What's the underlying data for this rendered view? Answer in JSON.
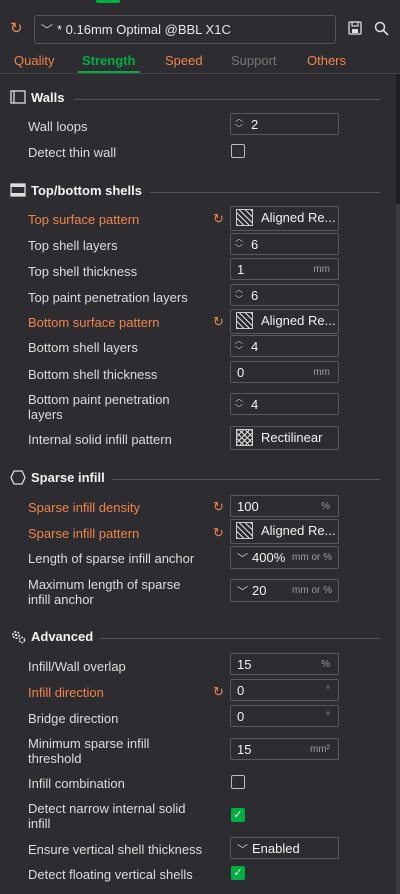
{
  "header": {
    "preset_name": "* 0.16mm Optimal @BBL X1C",
    "icons": {
      "reset": "reset-icon",
      "save": "save-icon",
      "search": "search-icon"
    }
  },
  "tabs": [
    {
      "label": "Quality",
      "state": "modified"
    },
    {
      "label": "Strength",
      "state": "active"
    },
    {
      "label": "Speed",
      "state": "modified"
    },
    {
      "label": "Support",
      "state": "disabled"
    },
    {
      "label": "Others",
      "state": "modified"
    }
  ],
  "colors": {
    "accent": "#00ae42",
    "modified": "#f0844a",
    "background": "#2d2d31"
  },
  "walls": {
    "title": "Walls",
    "wall_loops": {
      "label": "Wall loops",
      "value": "2"
    },
    "detect_thin_wall": {
      "label": "Detect thin wall",
      "checked": false
    }
  },
  "shells": {
    "title": "Top/bottom shells",
    "top_surface_pattern": {
      "label": "Top surface pattern",
      "value": "Aligned Re..."
    },
    "top_shell_layers": {
      "label": "Top shell layers",
      "value": "6"
    },
    "top_shell_thickness": {
      "label": "Top shell thickness",
      "value": "1",
      "unit": "mm"
    },
    "top_paint_layers": {
      "label": "Top paint penetration layers",
      "value": "6"
    },
    "bottom_surface_pattern": {
      "label": "Bottom surface pattern",
      "value": "Aligned Re..."
    },
    "bottom_shell_layers": {
      "label": "Bottom shell layers",
      "value": "4"
    },
    "bottom_shell_thickness": {
      "label": "Bottom shell thickness",
      "value": "0",
      "unit": "mm"
    },
    "bottom_paint_layers": {
      "label_line1": "Bottom paint penetration",
      "label_line2": "layers",
      "value": "4"
    },
    "internal_solid_pattern": {
      "label": "Internal solid infill pattern",
      "value": "Rectilinear"
    }
  },
  "sparse": {
    "title": "Sparse infill",
    "density": {
      "label": "Sparse infill density",
      "value": "100",
      "unit": "%"
    },
    "pattern": {
      "label": "Sparse infill pattern",
      "value": "Aligned Re..."
    },
    "anchor": {
      "label": "Length of sparse infill anchor",
      "value": "400%",
      "unit": "mm or %"
    },
    "anchor_max": {
      "label_line1": "Maximum length of sparse",
      "label_line2": "infill anchor",
      "value": "20",
      "unit": "mm or %"
    }
  },
  "advanced": {
    "title": "Advanced",
    "overlap": {
      "label": "Infill/Wall overlap",
      "value": "15",
      "unit": "%"
    },
    "infill_direction": {
      "label": "Infill direction",
      "value": "0",
      "unit": "°"
    },
    "bridge_direction": {
      "label": "Bridge direction",
      "value": "0",
      "unit": "°"
    },
    "min_sparse": {
      "label_line1": "Minimum sparse infill",
      "label_line2": "threshold",
      "value": "15",
      "unit": "mm²"
    },
    "infill_combination": {
      "label": "Infill combination",
      "checked": false
    },
    "narrow_solid": {
      "label_line1": "Detect narrow internal solid",
      "label_line2": "infill",
      "checked": true
    },
    "vertical_shell": {
      "label": "Ensure vertical shell thickness",
      "value": "Enabled"
    },
    "floating_shells": {
      "label": "Detect floating vertical shells",
      "checked": true
    }
  }
}
